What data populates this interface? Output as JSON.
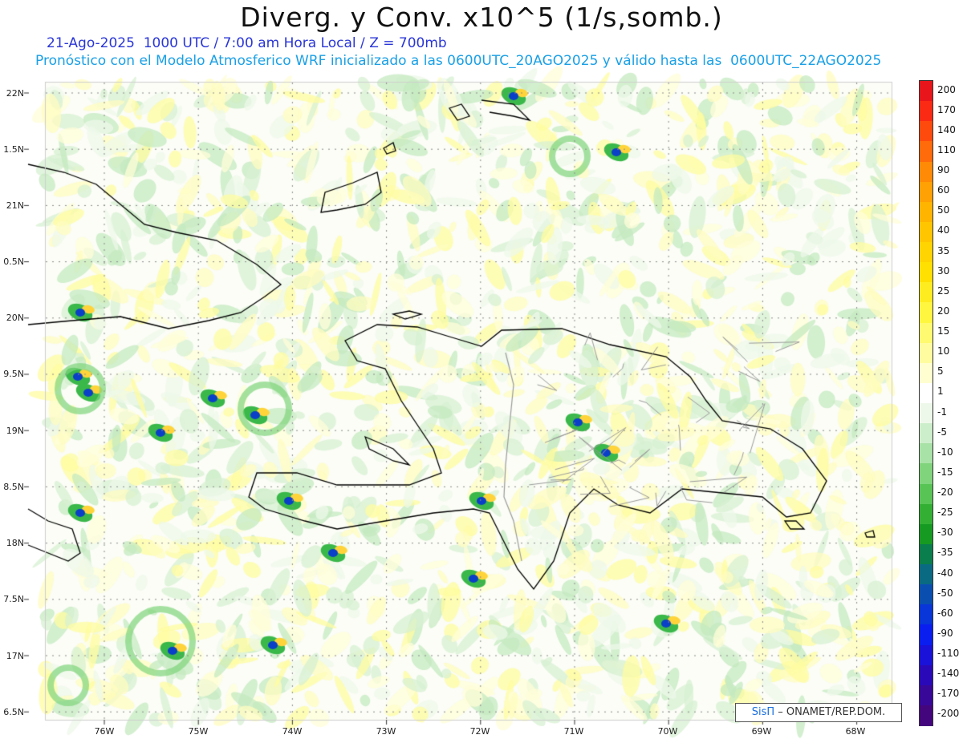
{
  "title": "Diverg. y Conv. x10^5 (1/s,somb.)",
  "subtitle1": "21-Ago-2025  1000 UTC / 7:00 am Hora Local / Z = 700mb",
  "subtitle2": "Pronóstico con el Modelo Atmosferico WRF inicializado a las 0600UTC_20AGO2025 y válido hasta las  0600UTC_22AGO2025",
  "axes": {
    "lat_labels": [
      "22N",
      "1.5N",
      "21N",
      "0.5N",
      "20N",
      "9.5N",
      "19N",
      "8.5N",
      "18N",
      "7.5N",
      "17N",
      "6.5N"
    ],
    "lon_labels": [
      "76W",
      "75W",
      "74W",
      "73W",
      "72W",
      "71W",
      "70W",
      "69W",
      "68W"
    ]
  },
  "colorbar": {
    "labels": [
      "200",
      "170",
      "140",
      "110",
      "90",
      "60",
      "50",
      "40",
      "35",
      "30",
      "25",
      "20",
      "15",
      "10",
      "5",
      "1",
      "-1",
      "-5",
      "-10",
      "-15",
      "-20",
      "-25",
      "-30",
      "-35",
      "-40",
      "-50",
      "-60",
      "-90",
      "-110",
      "-140",
      "-170",
      "-200"
    ],
    "colors": [
      "#e8161b",
      "#fa2a14",
      "#ff4a0e",
      "#ff6a0a",
      "#ff8a06",
      "#ffa004",
      "#ffb400",
      "#ffc600",
      "#ffd400",
      "#ffe000",
      "#ffec20",
      "#fff640",
      "#fffa70",
      "#fffca0",
      "#fffed0",
      "#ffffff",
      "#eef8ea",
      "#cdeecb",
      "#a8e2a6",
      "#7fd47c",
      "#58c455",
      "#33b034",
      "#169a22",
      "#0a7e4c",
      "#0a6a82",
      "#0a4fb0",
      "#0836d8",
      "#0a1ef0",
      "#1a12d8",
      "#2a0ab8",
      "#380898",
      "#44067c"
    ]
  },
  "credit": {
    "brand": "SisΠ",
    "text": " – ONAMET/REP.DOM."
  },
  "colors": {
    "title": "#111111",
    "subtitle1": "#2a36d6",
    "subtitle2": "#1aa0e6"
  }
}
